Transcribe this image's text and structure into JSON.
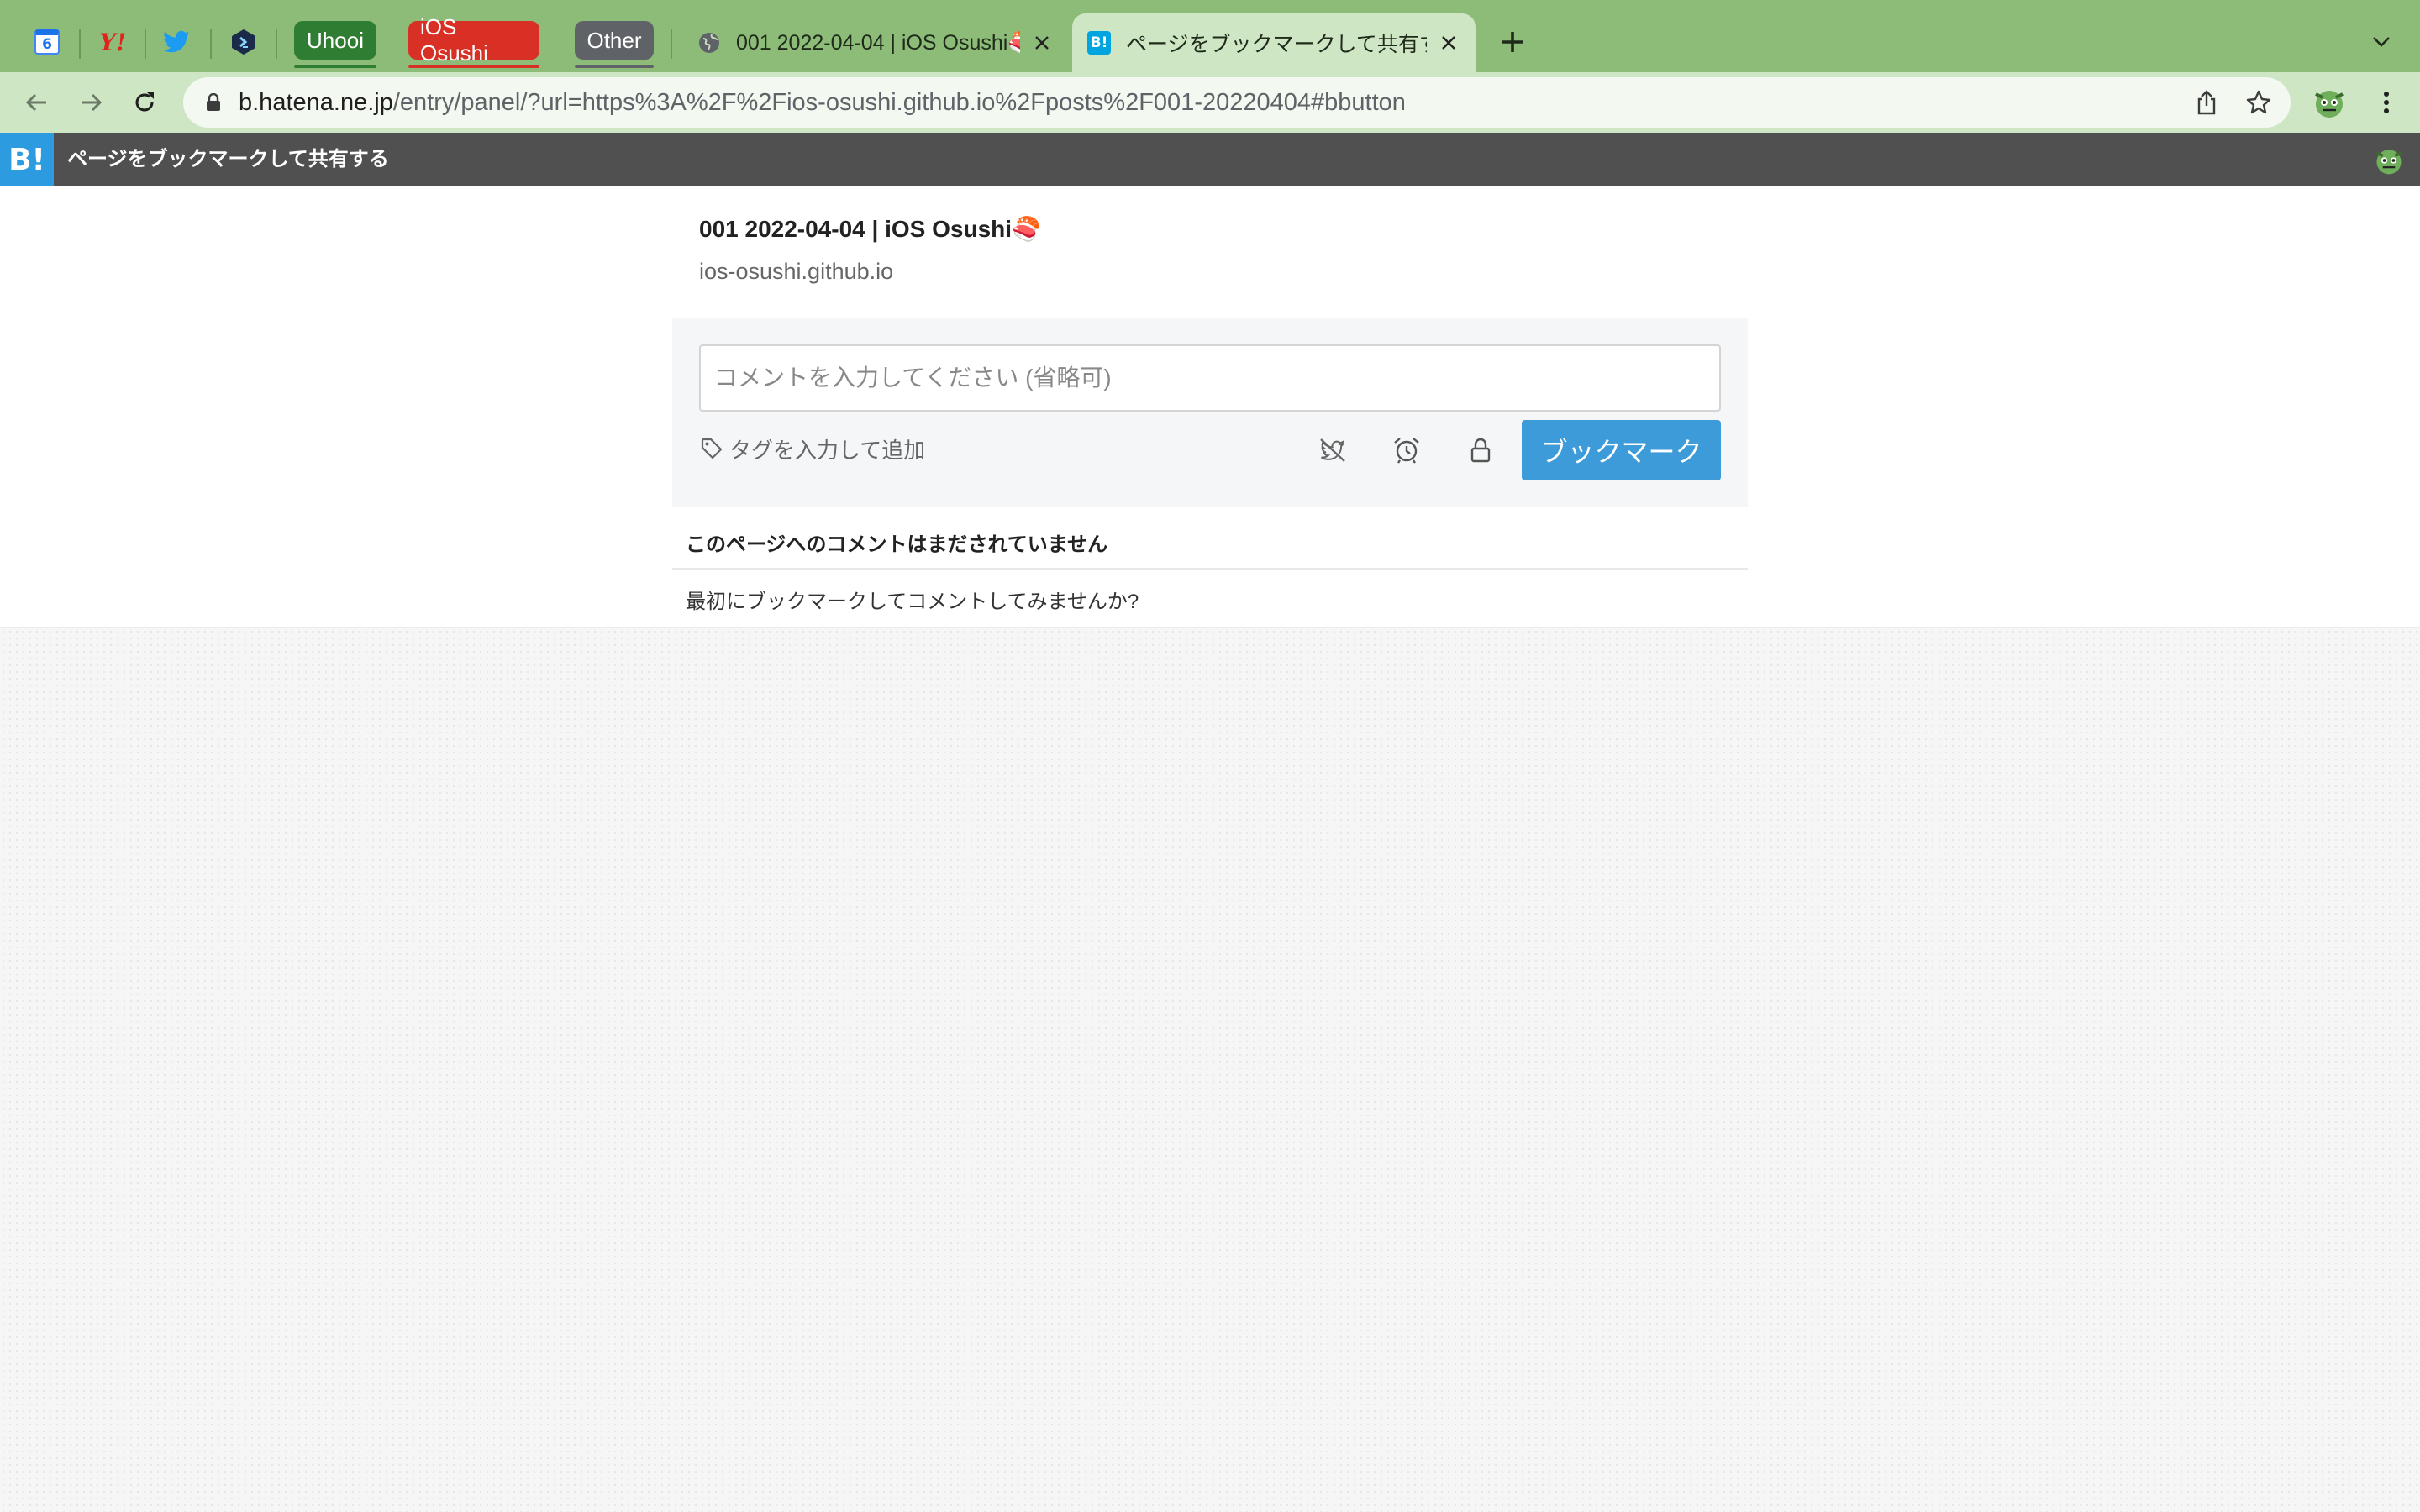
{
  "browser": {
    "pinned_tabs": [
      {
        "icon": "calendar-icon",
        "text": "6"
      },
      {
        "icon": "yahoo-icon",
        "text": "Y!"
      },
      {
        "icon": "twitter-icon"
      },
      {
        "icon": "code-cube-icon"
      }
    ],
    "tab_groups": [
      {
        "label": "Uhooi",
        "color": "#2e7d32"
      },
      {
        "label": "iOS Osushi",
        "color": "#d93025"
      },
      {
        "label": "Other",
        "color": "#5f6368"
      }
    ],
    "tabs": [
      {
        "title": "001 2022-04-04 | iOS Osushi🍣",
        "favicon": "globe-icon",
        "active": false
      },
      {
        "title": "ページをブックマークして共有する",
        "favicon": "hatena-bookmark-icon",
        "favicon_text": "B!",
        "active": true
      }
    ],
    "url": {
      "host": "b.hatena.ne.jp",
      "path": "/entry/panel/?url=https%3A%2F%2Fios-osushi.github.io%2Fposts%2F001-20220404#bbutton"
    },
    "colors": {
      "tabstrip": "#8dbc79",
      "toolbar": "#cfe6c5"
    }
  },
  "hatena": {
    "logo_text": "B!",
    "header_title": "ページをブックマークして共有する",
    "brand_color": "#2d9be0"
  },
  "entry": {
    "title": "001 2022-04-04 | iOS Osushi🍣",
    "domain": "ios-osushi.github.io"
  },
  "form": {
    "comment_placeholder": "コメントを入力してください (省略可)",
    "comment_value": "",
    "tag_placeholder": "タグを入力して追加",
    "bookmark_button": "ブックマーク",
    "button_color": "#3d9bd9"
  },
  "comments": {
    "heading": "このページへのコメントはまだされていません",
    "prompt": "最初にブックマークしてコメントしてみませんか?"
  }
}
